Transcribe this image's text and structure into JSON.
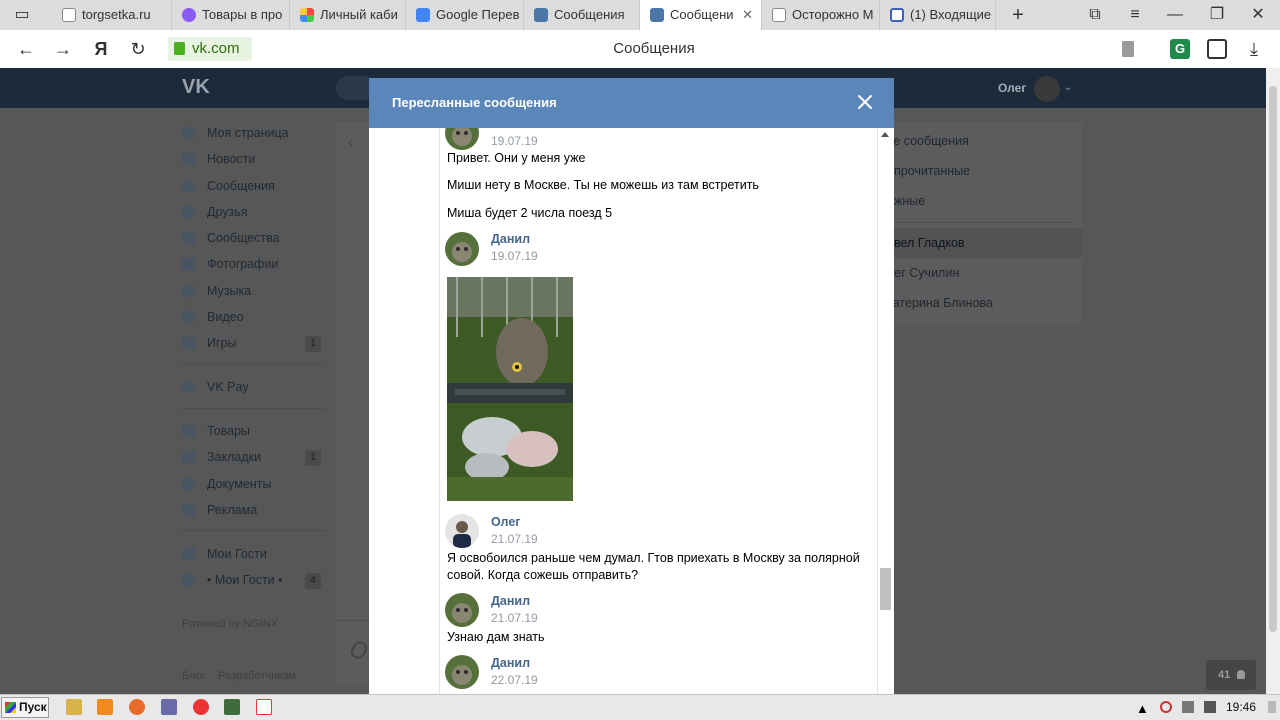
{
  "browser": {
    "tabs": [
      {
        "label": "torgsetka.ru",
        "icon": "page-icon",
        "active": false
      },
      {
        "label": "Товары в про",
        "icon": "star-icon",
        "active": false
      },
      {
        "label": "Личный каби",
        "icon": "colorful-icon",
        "active": false
      },
      {
        "label": "Google Перев",
        "icon": "google-icon",
        "active": false
      },
      {
        "label": "Сообщения",
        "icon": "vk-message-icon",
        "active": false
      },
      {
        "label": "Сообщени",
        "icon": "vk-message-icon",
        "active": true
      },
      {
        "label": "Осторожно М",
        "icon": "page-icon",
        "active": false
      },
      {
        "label": "(1) Входящие",
        "icon": "mail-icon",
        "active": false
      }
    ],
    "tab_close": "✕",
    "new_tab": "+",
    "address": "vk.com",
    "page_title": "Сообщения"
  },
  "vk": {
    "user_name": "Олег",
    "left_menu": [
      {
        "label": "Моя страница",
        "icon": "user-icon"
      },
      {
        "label": "Новости",
        "icon": "news-icon"
      },
      {
        "label": "Сообщения",
        "icon": "message-icon"
      },
      {
        "label": "Друзья",
        "icon": "friend-icon"
      },
      {
        "label": "Сообщества",
        "icon": "group-icon"
      },
      {
        "label": "Фотографии",
        "icon": "camera-icon"
      },
      {
        "label": "Музыка",
        "icon": "music-icon"
      },
      {
        "label": "Видео",
        "icon": "video-icon"
      },
      {
        "label": "Игры",
        "icon": "gamepad-icon",
        "count": "1"
      },
      {
        "label": "VK Pay",
        "icon": "pay-icon"
      },
      {
        "label": "Товары",
        "icon": "bag-icon"
      },
      {
        "label": "Закладки",
        "icon": "star-icon",
        "count": "1"
      },
      {
        "label": "Документы",
        "icon": "document-icon"
      },
      {
        "label": "Реклама",
        "icon": "megaphone-icon"
      },
      {
        "label": "Мои Гости",
        "icon": "grid-icon"
      },
      {
        "label": "• Мои Гости •",
        "icon": "grid-icon",
        "count": "4"
      }
    ],
    "powered_by": "Powered by NGINX",
    "footer_links": [
      "Блог",
      "Разработчикам"
    ],
    "right_menu": [
      {
        "label": "се сообщения"
      },
      {
        "label": "епрочитанные"
      },
      {
        "label": "ажные"
      },
      {
        "label": "авел Гладков",
        "selected": true
      },
      {
        "label": "лег Сучилин"
      },
      {
        "label": "катерина Блинова"
      }
    ],
    "online_count": "41"
  },
  "modal": {
    "title": "Пересланные сообщения",
    "messages": [
      {
        "type": "date_only",
        "date": "19.07.19",
        "avatar": "owl"
      },
      {
        "type": "text",
        "text": "Привет. Они у меня уже"
      },
      {
        "type": "text",
        "text": "Миши нету в Москве. Ты не можешь из там встретить"
      },
      {
        "type": "text",
        "text": "Миша будет 2 числа поезд 5"
      },
      {
        "type": "header",
        "name": "Данил",
        "date": "19.07.19",
        "avatar": "owl"
      },
      {
        "type": "photo",
        "alt": "owl-photo"
      },
      {
        "type": "header",
        "name": "Олег",
        "date": "21.07.19",
        "avatar": "man"
      },
      {
        "type": "text",
        "text": "Я освобоился раньше чем думал. Гтов приехать в Москву за полярной совой. Когда сожешь отправить?"
      },
      {
        "type": "header",
        "name": "Данил",
        "date": "21.07.19",
        "avatar": "owl"
      },
      {
        "type": "text",
        "text": "Узнаю дам знать"
      },
      {
        "type": "header",
        "name": "Данил",
        "date": "22.07.19",
        "avatar": "owl"
      }
    ]
  },
  "taskbar": {
    "start_label": "Пуск",
    "clock": "19:46"
  }
}
